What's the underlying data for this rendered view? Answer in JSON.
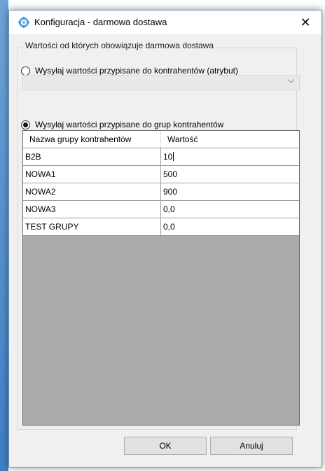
{
  "window": {
    "title": "Konfiguracja - darmowa dostawa",
    "icon": "gear-icon",
    "close_glyph": "✕"
  },
  "group": {
    "legend": "Wartości od których obowiązuje darmowa dostawa"
  },
  "options": {
    "by_attribute": {
      "label": "Wysyłaj wartości przypisane do kontrahentów (atrybut)",
      "selected": false
    },
    "by_group": {
      "label": "Wysyłaj wartości przypisane do grup kontrahentów",
      "selected": true
    }
  },
  "attribute_combo": {
    "value": "",
    "disabled": true
  },
  "grid": {
    "columns": [
      "Nazwa grupy kontrahentów",
      "Wartość"
    ],
    "rows": [
      {
        "name": "B2B",
        "value": "10"
      },
      {
        "name": "NOWA1",
        "value": "500"
      },
      {
        "name": "NOWA2",
        "value": "900"
      },
      {
        "name": "NOWA3",
        "value": "0,0"
      },
      {
        "name": "TEST GRUPY",
        "value": "0,0"
      }
    ],
    "empty_area_color": "#ababab"
  },
  "buttons": {
    "ok": "OK",
    "cancel": "Anuluj"
  }
}
